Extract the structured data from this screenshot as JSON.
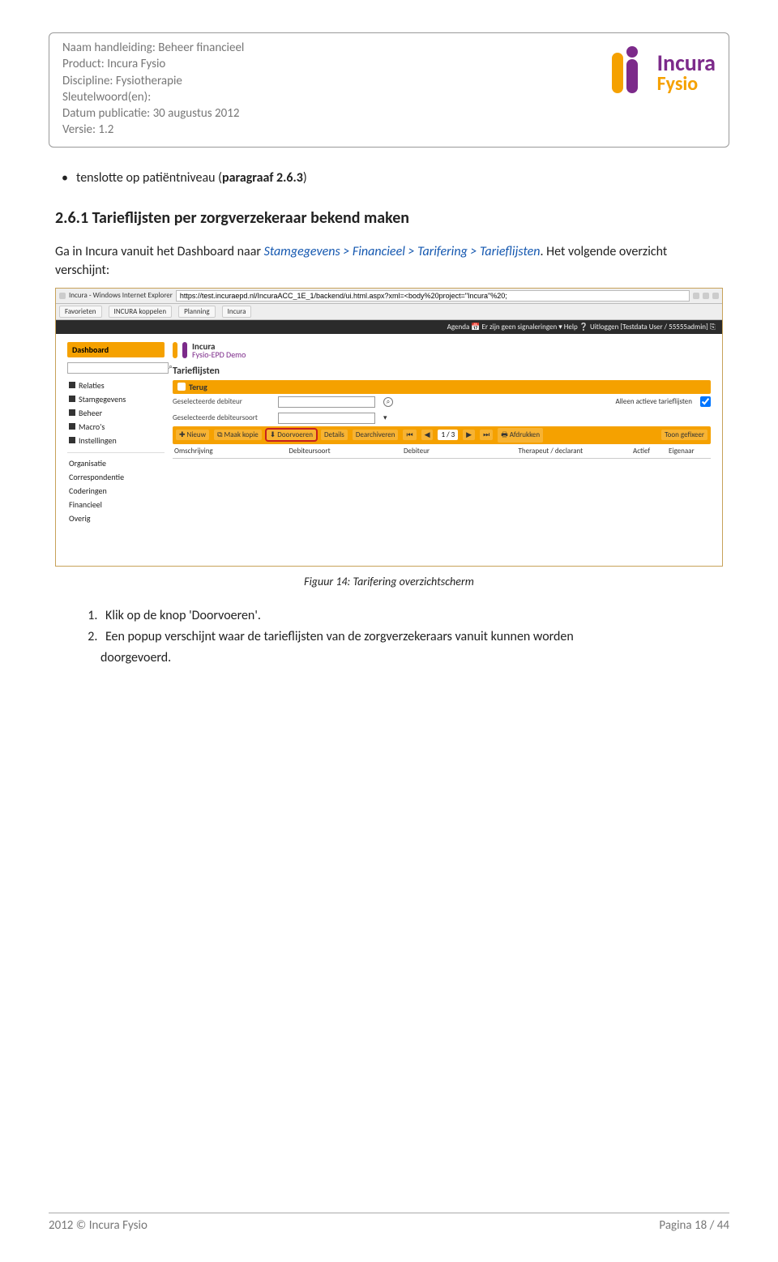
{
  "header": {
    "meta": {
      "l1_label": "Naam handleiding: ",
      "l1_value": "Beheer financieel",
      "l2_label": "Product: ",
      "l2_value": "Incura Fysio",
      "l3_label": "Discipline: ",
      "l3_value": "Fysiotherapie",
      "l4_label": "Sleutelwoord(en):",
      "l4_value": "",
      "l5_label": "Datum publicatie: ",
      "l5_value": "30 augustus 2012",
      "l6_label": "Versie: ",
      "l6_value": "1.2"
    },
    "logo": {
      "line1": "Incura",
      "line2": "Fysio"
    }
  },
  "content": {
    "bullet_prefix": "tenslotte op patiëntniveau (",
    "bullet_bold": "paragraaf 2.6.3",
    "bullet_suffix": ")",
    "section_heading": "2.6.1 Tarieflijsten per zorgverzekeraar bekend maken",
    "para_prefix": "Ga in Incura vanuit het Dashboard naar ",
    "para_link": "Stamgegevens > Financieel > Tarifering > Tarieflijsten",
    "para_suffix": ". Het volgende overzicht verschijnt:"
  },
  "screenshot": {
    "window_title": "Incura - Windows Internet Explorer",
    "address": "https://test.incuraepd.nl/IncuraACC_1E_1/backend/ui.html.aspx?xml=<body%20project=\"Incura\"%20;",
    "fav_label": "Favorieten",
    "tab_koppelen": "INCURA koppelen",
    "tab_planning": "Planning",
    "tab_incura": "Incura",
    "darkbar": "Agenda 📅   Er zijn geen signaleringen ▾   Help ❔   Uitloggen [Testdata User / 55555admin] ⎘",
    "brand_l1": "Incura",
    "brand_l2": "Fysio-EPD",
    "brand_l3": "Demo",
    "sidebar": {
      "dashboard": "Dashboard",
      "items": [
        "Relaties",
        "Stamgegevens",
        "Beheer",
        "Macro's",
        "Instellingen"
      ],
      "sub": [
        "Organisatie",
        "Correspondentie",
        "Coderingen",
        "Financieel",
        "Overig"
      ]
    },
    "panel_title": "Tarieflijsten",
    "back_label": "Terug",
    "row1_label": "Geselecteerde debiteur",
    "row2_label": "Geselecteerde debiteursoort",
    "row1_right": "Alleen actieve tarieflijsten",
    "toolbar": {
      "nieuw": "Nieuw",
      "kopie": "Maak kopie",
      "doorvoeren": "Doorvoeren",
      "details": "Details",
      "archiveren": "Dearchiveren",
      "pager": "1 / 3",
      "afdrukken": "Afdrukken",
      "toon": "Toon gefixeer"
    },
    "thead": [
      "Omschrijving",
      "Debiteursoort",
      "Debiteur",
      "Therapeut / declarant",
      "Actief",
      "Eigenaar"
    ]
  },
  "caption": "Figuur 14: Tarifering overzichtscherm",
  "steps": {
    "s1": "Klik op de knop 'Doorvoeren'.",
    "s2": "Een popup verschijnt waar de tarieflijsten van de zorgverzekeraars vanuit kunnen worden",
    "s2b": "doorgevoerd."
  },
  "footer": {
    "left": "2012 © Incura Fysio",
    "right_label": "Pagina ",
    "right_page": "18",
    "right_sep": " / ",
    "right_total": "44"
  }
}
